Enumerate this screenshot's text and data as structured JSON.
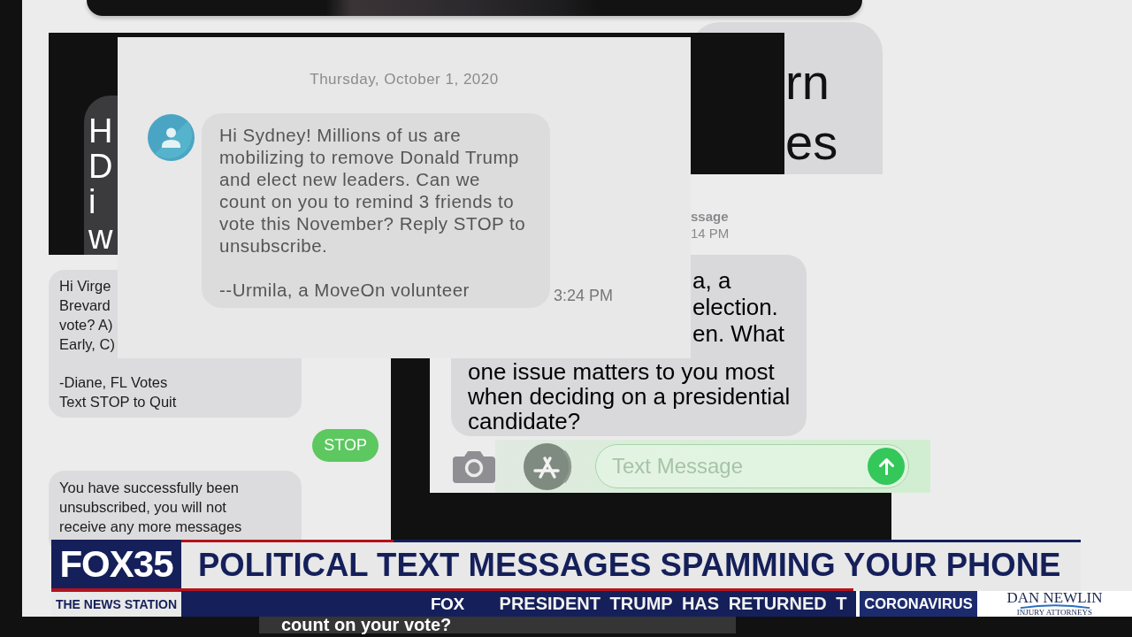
{
  "dark_screenshot": {
    "message": "H\nD\ni\nw"
  },
  "light_bubble": {
    "message": "rn\nes"
  },
  "fl_votes_screenshot": {
    "messages": [
      {
        "kind": "received",
        "parts": [
          "Hi Virge\nBrevard\nvote? A)\nEarly, C)",
          "-Diane, FL Votes\nText STOP to Quit"
        ]
      },
      {
        "kind": "sent",
        "parts": [
          "STOP"
        ]
      },
      {
        "kind": "received",
        "parts": [
          "You have successfully been\nunsubscribed, you will not\nreceive any more messages"
        ]
      }
    ]
  },
  "imessage_screenshot": {
    "header": {
      "title": "ssage",
      "subtitle": "14 PM"
    },
    "message_parts": [
      "a, a\nelection.\nen. What",
      "one issue matters to you most\nwhen deciding on a presidential\ncandidate?"
    ],
    "input": {
      "placeholder": "Text Message"
    }
  },
  "moveon_screenshot": {
    "date": "Thursday, October 1, 2020",
    "message": "Hi Sydney! Millions of us are\nmobilizing to remove Donald Trump\nand elect new leaders. Can we\ncount on you to remind 3 friends to\nvote this November? Reply STOP to\nunsubscribe.\n\n--Urmila, a MoveOn volunteer",
    "time": "3:24 PM"
  },
  "caption": "count on your vote?",
  "lower_third": {
    "logo": "FOX35",
    "tagline": "THE NEWS STATION",
    "headline": "POLITICAL TEXT MESSAGES SPAMMING YOUR PHONE",
    "ticker": {
      "network": "FOX",
      "text": "PRESIDENT TRUMP HAS RETURNED T",
      "topic": "CORONAVIRUS"
    },
    "sponsor": {
      "name": "DAN NEWLIN",
      "tagline": "INJURY ATTORNEYS"
    }
  }
}
